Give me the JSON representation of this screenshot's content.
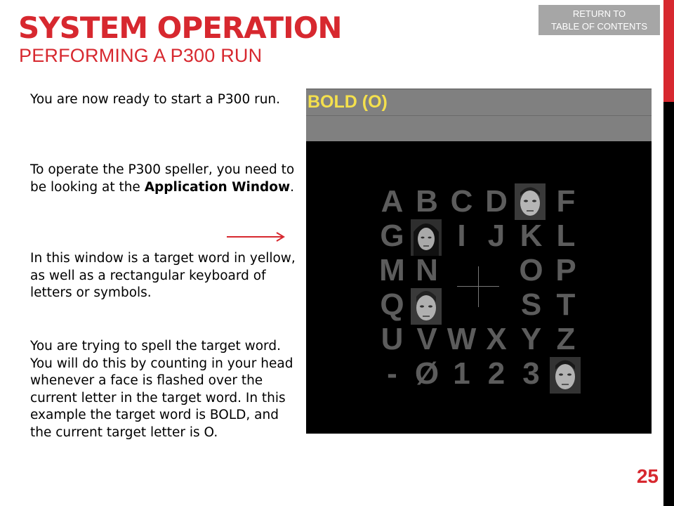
{
  "header": {
    "title": "SYSTEM OPERATION",
    "subtitle": "PERFORMING A P300 RUN",
    "return_button_line1": "RETURN TO",
    "return_button_line2": "TABLE OF CONTENTS"
  },
  "body": {
    "p1": "You are now ready to start a P300 run.",
    "p2_before": "To operate the P300 speller, you need to be looking at the ",
    "p2_bold": "Application Window",
    "p2_after": ".",
    "p3": "In this window is a target word in yellow, as well as a rectangular keyboard of letters or symbols.",
    "p4": "You are trying to spell the target word.  You will do this by counting in your head whenever a face is flashed over the current letter in the target word.  In this example the target word is BOLD, and the current target letter is O."
  },
  "speller": {
    "target_word": "BOLD (O)",
    "grid_rows": [
      [
        "A",
        "B",
        "C",
        "D",
        "",
        "F"
      ],
      [
        "G",
        "",
        "I",
        "J",
        "K",
        "L"
      ],
      [
        "M",
        "N",
        "",
        "",
        "O",
        "P"
      ],
      [
        "Q",
        "",
        "",
        "",
        "S",
        "T"
      ],
      [
        "U",
        "V",
        "W",
        "X",
        "Y",
        "Z"
      ],
      [
        "-",
        "Ø",
        "1",
        "2",
        "3",
        ""
      ]
    ],
    "colors": {
      "target_word": "#f4e04d",
      "letters": "#5c5c5c",
      "window_bg": "#000000",
      "bar_bg": "#808080"
    }
  },
  "colors": {
    "accent": "#d7282f",
    "return_button": "#a6a6a6"
  },
  "page_number": "25"
}
